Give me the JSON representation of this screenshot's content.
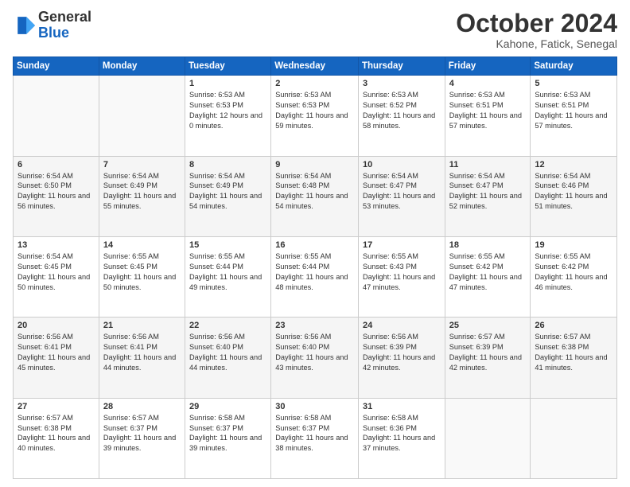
{
  "header": {
    "logo_general": "General",
    "logo_blue": "Blue",
    "month_title": "October 2024",
    "location": "Kahone, Fatick, Senegal"
  },
  "weekdays": [
    "Sunday",
    "Monday",
    "Tuesday",
    "Wednesday",
    "Thursday",
    "Friday",
    "Saturday"
  ],
  "weeks": [
    {
      "shade": false,
      "days": [
        {
          "num": "",
          "info": ""
        },
        {
          "num": "",
          "info": ""
        },
        {
          "num": "1",
          "info": "Sunrise: 6:53 AM\nSunset: 6:53 PM\nDaylight: 12 hours and 0 minutes."
        },
        {
          "num": "2",
          "info": "Sunrise: 6:53 AM\nSunset: 6:53 PM\nDaylight: 11 hours and 59 minutes."
        },
        {
          "num": "3",
          "info": "Sunrise: 6:53 AM\nSunset: 6:52 PM\nDaylight: 11 hours and 58 minutes."
        },
        {
          "num": "4",
          "info": "Sunrise: 6:53 AM\nSunset: 6:51 PM\nDaylight: 11 hours and 57 minutes."
        },
        {
          "num": "5",
          "info": "Sunrise: 6:53 AM\nSunset: 6:51 PM\nDaylight: 11 hours and 57 minutes."
        }
      ]
    },
    {
      "shade": true,
      "days": [
        {
          "num": "6",
          "info": "Sunrise: 6:54 AM\nSunset: 6:50 PM\nDaylight: 11 hours and 56 minutes."
        },
        {
          "num": "7",
          "info": "Sunrise: 6:54 AM\nSunset: 6:49 PM\nDaylight: 11 hours and 55 minutes."
        },
        {
          "num": "8",
          "info": "Sunrise: 6:54 AM\nSunset: 6:49 PM\nDaylight: 11 hours and 54 minutes."
        },
        {
          "num": "9",
          "info": "Sunrise: 6:54 AM\nSunset: 6:48 PM\nDaylight: 11 hours and 54 minutes."
        },
        {
          "num": "10",
          "info": "Sunrise: 6:54 AM\nSunset: 6:47 PM\nDaylight: 11 hours and 53 minutes."
        },
        {
          "num": "11",
          "info": "Sunrise: 6:54 AM\nSunset: 6:47 PM\nDaylight: 11 hours and 52 minutes."
        },
        {
          "num": "12",
          "info": "Sunrise: 6:54 AM\nSunset: 6:46 PM\nDaylight: 11 hours and 51 minutes."
        }
      ]
    },
    {
      "shade": false,
      "days": [
        {
          "num": "13",
          "info": "Sunrise: 6:54 AM\nSunset: 6:45 PM\nDaylight: 11 hours and 50 minutes."
        },
        {
          "num": "14",
          "info": "Sunrise: 6:55 AM\nSunset: 6:45 PM\nDaylight: 11 hours and 50 minutes."
        },
        {
          "num": "15",
          "info": "Sunrise: 6:55 AM\nSunset: 6:44 PM\nDaylight: 11 hours and 49 minutes."
        },
        {
          "num": "16",
          "info": "Sunrise: 6:55 AM\nSunset: 6:44 PM\nDaylight: 11 hours and 48 minutes."
        },
        {
          "num": "17",
          "info": "Sunrise: 6:55 AM\nSunset: 6:43 PM\nDaylight: 11 hours and 47 minutes."
        },
        {
          "num": "18",
          "info": "Sunrise: 6:55 AM\nSunset: 6:42 PM\nDaylight: 11 hours and 47 minutes."
        },
        {
          "num": "19",
          "info": "Sunrise: 6:55 AM\nSunset: 6:42 PM\nDaylight: 11 hours and 46 minutes."
        }
      ]
    },
    {
      "shade": true,
      "days": [
        {
          "num": "20",
          "info": "Sunrise: 6:56 AM\nSunset: 6:41 PM\nDaylight: 11 hours and 45 minutes."
        },
        {
          "num": "21",
          "info": "Sunrise: 6:56 AM\nSunset: 6:41 PM\nDaylight: 11 hours and 44 minutes."
        },
        {
          "num": "22",
          "info": "Sunrise: 6:56 AM\nSunset: 6:40 PM\nDaylight: 11 hours and 44 minutes."
        },
        {
          "num": "23",
          "info": "Sunrise: 6:56 AM\nSunset: 6:40 PM\nDaylight: 11 hours and 43 minutes."
        },
        {
          "num": "24",
          "info": "Sunrise: 6:56 AM\nSunset: 6:39 PM\nDaylight: 11 hours and 42 minutes."
        },
        {
          "num": "25",
          "info": "Sunrise: 6:57 AM\nSunset: 6:39 PM\nDaylight: 11 hours and 42 minutes."
        },
        {
          "num": "26",
          "info": "Sunrise: 6:57 AM\nSunset: 6:38 PM\nDaylight: 11 hours and 41 minutes."
        }
      ]
    },
    {
      "shade": false,
      "days": [
        {
          "num": "27",
          "info": "Sunrise: 6:57 AM\nSunset: 6:38 PM\nDaylight: 11 hours and 40 minutes."
        },
        {
          "num": "28",
          "info": "Sunrise: 6:57 AM\nSunset: 6:37 PM\nDaylight: 11 hours and 39 minutes."
        },
        {
          "num": "29",
          "info": "Sunrise: 6:58 AM\nSunset: 6:37 PM\nDaylight: 11 hours and 39 minutes."
        },
        {
          "num": "30",
          "info": "Sunrise: 6:58 AM\nSunset: 6:37 PM\nDaylight: 11 hours and 38 minutes."
        },
        {
          "num": "31",
          "info": "Sunrise: 6:58 AM\nSunset: 6:36 PM\nDaylight: 11 hours and 37 minutes."
        },
        {
          "num": "",
          "info": ""
        },
        {
          "num": "",
          "info": ""
        }
      ]
    }
  ]
}
